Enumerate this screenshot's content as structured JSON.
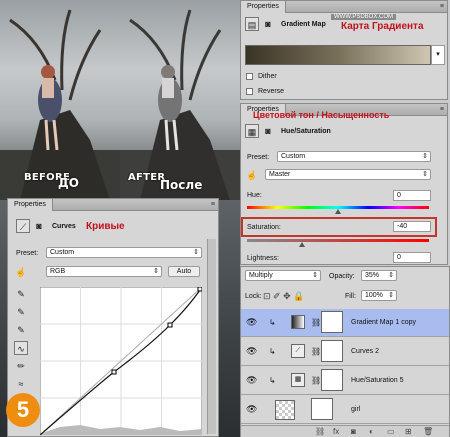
{
  "captions": {
    "before_en": "BEFORE",
    "before_ru": "ДО",
    "after_en": "AFTER",
    "after_ru": "После"
  },
  "gradient_panel": {
    "tab": "Properties",
    "menu": "≡",
    "title": "Gradient Map",
    "watermark": "WWW.PSDBOX.COM",
    "ru_title": "Карта Градиента",
    "dither": "Dither",
    "reverse": "Reverse"
  },
  "huesat_panel": {
    "tab": "Properties",
    "menu": "≡",
    "title": "Hue/Saturation",
    "ru_title": "Цветовой тон / Насыщенность",
    "preset_label": "Preset:",
    "preset": "Custom",
    "channel": "Master",
    "hue_label": "Hue:",
    "hue": "0",
    "sat_label": "Saturation:",
    "sat": "-40",
    "sat_level": 0.3,
    "light_label": "Lightness:",
    "light": "0"
  },
  "curves_panel": {
    "tab": "Properties",
    "menu": "≡",
    "title": "Curves",
    "ru_title": "Кривые",
    "preset_label": "Preset:",
    "preset": "Custom",
    "channel": "RGB",
    "auto": "Auto"
  },
  "layers_panel": {
    "blend_mode": "Multiply",
    "opacity_label": "Opacity:",
    "opacity": "35%",
    "lock_label": "Lock:",
    "fill_label": "Fill:",
    "fill": "100%",
    "layers": [
      {
        "name": "Gradient Map 1 copy",
        "selected": true
      },
      {
        "name": "Curves 2",
        "selected": false
      },
      {
        "name": "Hue/Saturation 5",
        "selected": false
      },
      {
        "name": "girl",
        "selected": false
      }
    ],
    "footer_icons": [
      "link-icon",
      "fx-icon",
      "mask-icon",
      "adjustment-icon",
      "group-icon",
      "new-layer-icon",
      "trash-icon"
    ]
  },
  "step_number": "5"
}
